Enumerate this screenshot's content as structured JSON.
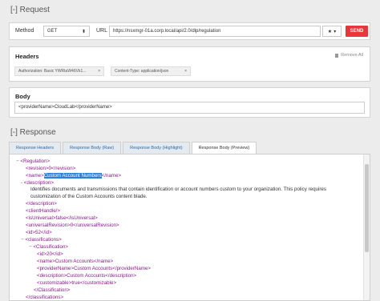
{
  "request": {
    "title": "[-] Request",
    "method_label": "Method",
    "method_value": "GET",
    "url_label": "URL",
    "url_value": "https://nsxmgr-01a.corp.local/api/2.0/dlp/regulation",
    "star_icon": "★",
    "star_caret": "▾",
    "send_label": "SEND"
  },
  "headers": {
    "title": "Headers",
    "remove_all": "Remove All",
    "items": [
      {
        "text": "Authorization: Basic YWRtaW46Vk1...",
        "close": "×"
      },
      {
        "text": "Content-Type: application/json",
        "close": "×"
      }
    ]
  },
  "body": {
    "title": "Body",
    "content": "<providerName>CloudLab</providerName>"
  },
  "response": {
    "title": "[-] Response",
    "tabs": [
      "Response Headers",
      "Response Body (Raw)",
      "Response Body (Highlight)",
      "Response Body (Preview)"
    ],
    "active_tab": 3,
    "description_text": "Identifies documents and transmissions that contain identification or account numbers custom to your organization. This policy requires customization of the Custom Accounts content blade.",
    "lines": {
      "regulation_open": "<Regulation>",
      "revision": "<revision>0</revision>",
      "name_pre": "<name>",
      "name_val": "Custom Account Numbers",
      "name_post": "</name>",
      "description_open": "<description>",
      "description_close": "</description>",
      "clienthandle": "<clientHandle/>",
      "isuniversal": "<isUniversal>false</isUniversal>",
      "universalrevision": "<universalRevision>0</universalRevision>",
      "id": "<id>52</id>",
      "classifications_open": "<classifications>",
      "classification_open": "<Classification>",
      "c_id": "<id>20</id>",
      "c_name": "<name>Custom Accounts</name>",
      "c_provider": "<providerName>Custom Accounts</providerName>",
      "c_description": "<description>Custom Accounts</description>",
      "c_customizable": "<customizable>true</customizable>",
      "classification_close": "</Classification>",
      "classifications_close": "</classifications>"
    },
    "toggle_minus": "−",
    "toggle_dash": "-"
  }
}
